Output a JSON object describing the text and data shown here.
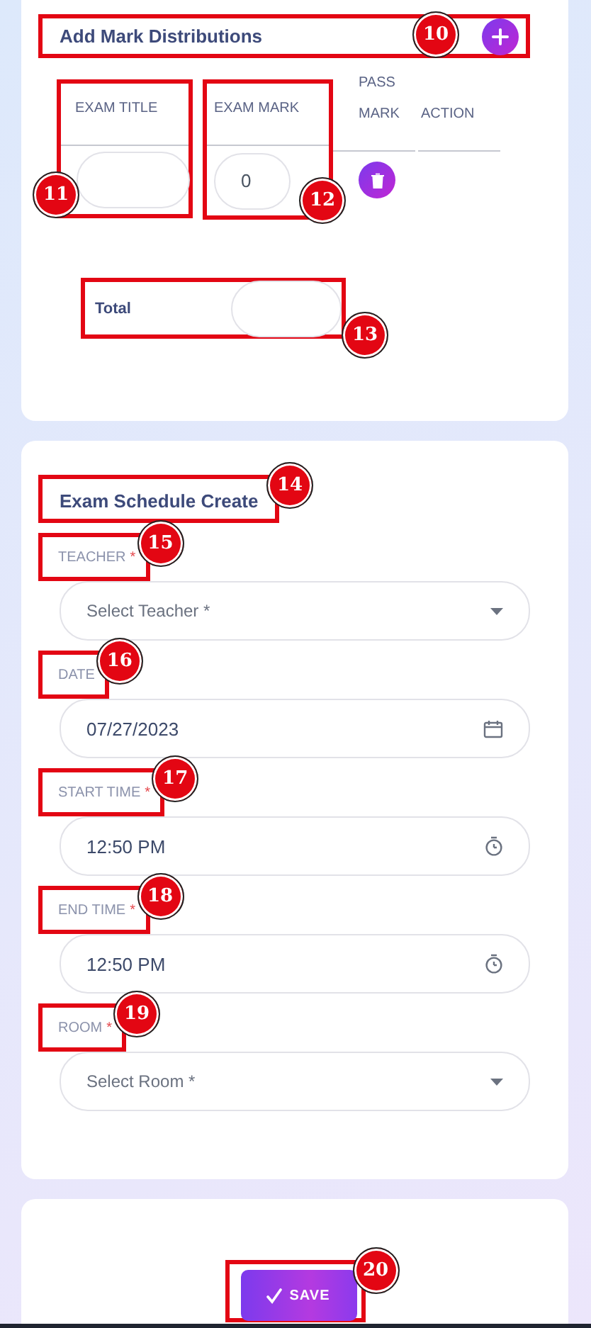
{
  "mark_distributions": {
    "title": "Add Mark Distributions",
    "callout": "10",
    "columns": [
      {
        "label": "EXAM TITLE",
        "callout": "11"
      },
      {
        "label": "EXAM MARK",
        "callout": "12"
      },
      {
        "label": "PASS MARK"
      },
      {
        "label": "ACTION"
      }
    ],
    "rows": [
      {
        "exam_mark": "0"
      }
    ],
    "total": {
      "label": "Total",
      "callout": "13"
    }
  },
  "exam_schedule": {
    "title": "Exam Schedule Create",
    "callout": "14",
    "fields": [
      {
        "kind": "select",
        "label": "TEACHER",
        "required_mark": "*",
        "placeholder": "Select Teacher *",
        "callout": "15"
      },
      {
        "kind": "date",
        "label": "DATE",
        "value": "07/27/2023",
        "callout": "16"
      },
      {
        "kind": "time",
        "label": "START TIME",
        "required_mark": "*",
        "value": "12:50 PM",
        "callout": "17"
      },
      {
        "kind": "time",
        "label": "END TIME",
        "required_mark": "*",
        "value": "12:50 PM",
        "callout": "18"
      },
      {
        "kind": "select",
        "label": "ROOM",
        "required_mark": "*",
        "placeholder": "Select Room *",
        "callout": "19"
      }
    ]
  },
  "footer": {
    "button": "SAVE",
    "callout": "20"
  }
}
